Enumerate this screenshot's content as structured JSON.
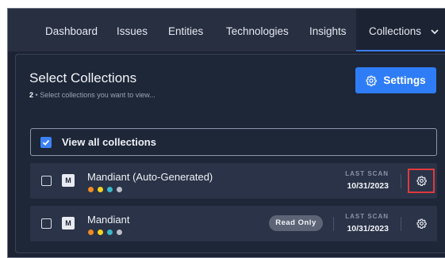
{
  "nav": {
    "items": [
      {
        "label": "Dashboard"
      },
      {
        "label": "Issues"
      },
      {
        "label": "Entities"
      },
      {
        "label": "Technologies"
      },
      {
        "label": "Insights"
      },
      {
        "label": "Collections",
        "active": true
      }
    ]
  },
  "header": {
    "title": "Select Collections",
    "count": "2",
    "subtitle": "Select collections you want to view...",
    "settings_label": "Settings"
  },
  "view_all": {
    "label": "View all collections",
    "checked": true
  },
  "collections": [
    {
      "badge": "M",
      "name": "Mandiant (Auto-Generated)",
      "last_scan_label": "LAST SCAN",
      "last_scan_date": "10/31/2023",
      "read_only": null,
      "dot_colors": [
        "#f08a24",
        "#f5d21f",
        "#39b8c9",
        "#b9bec8"
      ]
    },
    {
      "badge": "M",
      "name": "Mandiant",
      "last_scan_label": "LAST SCAN",
      "last_scan_date": "10/31/2023",
      "read_only": "Read Only",
      "dot_colors": [
        "#f08a24",
        "#f5d21f",
        "#39b8c9",
        "#b9bec8"
      ]
    }
  ],
  "colors": {
    "accent": "#2f7df6",
    "highlight": "#e03a3e"
  }
}
